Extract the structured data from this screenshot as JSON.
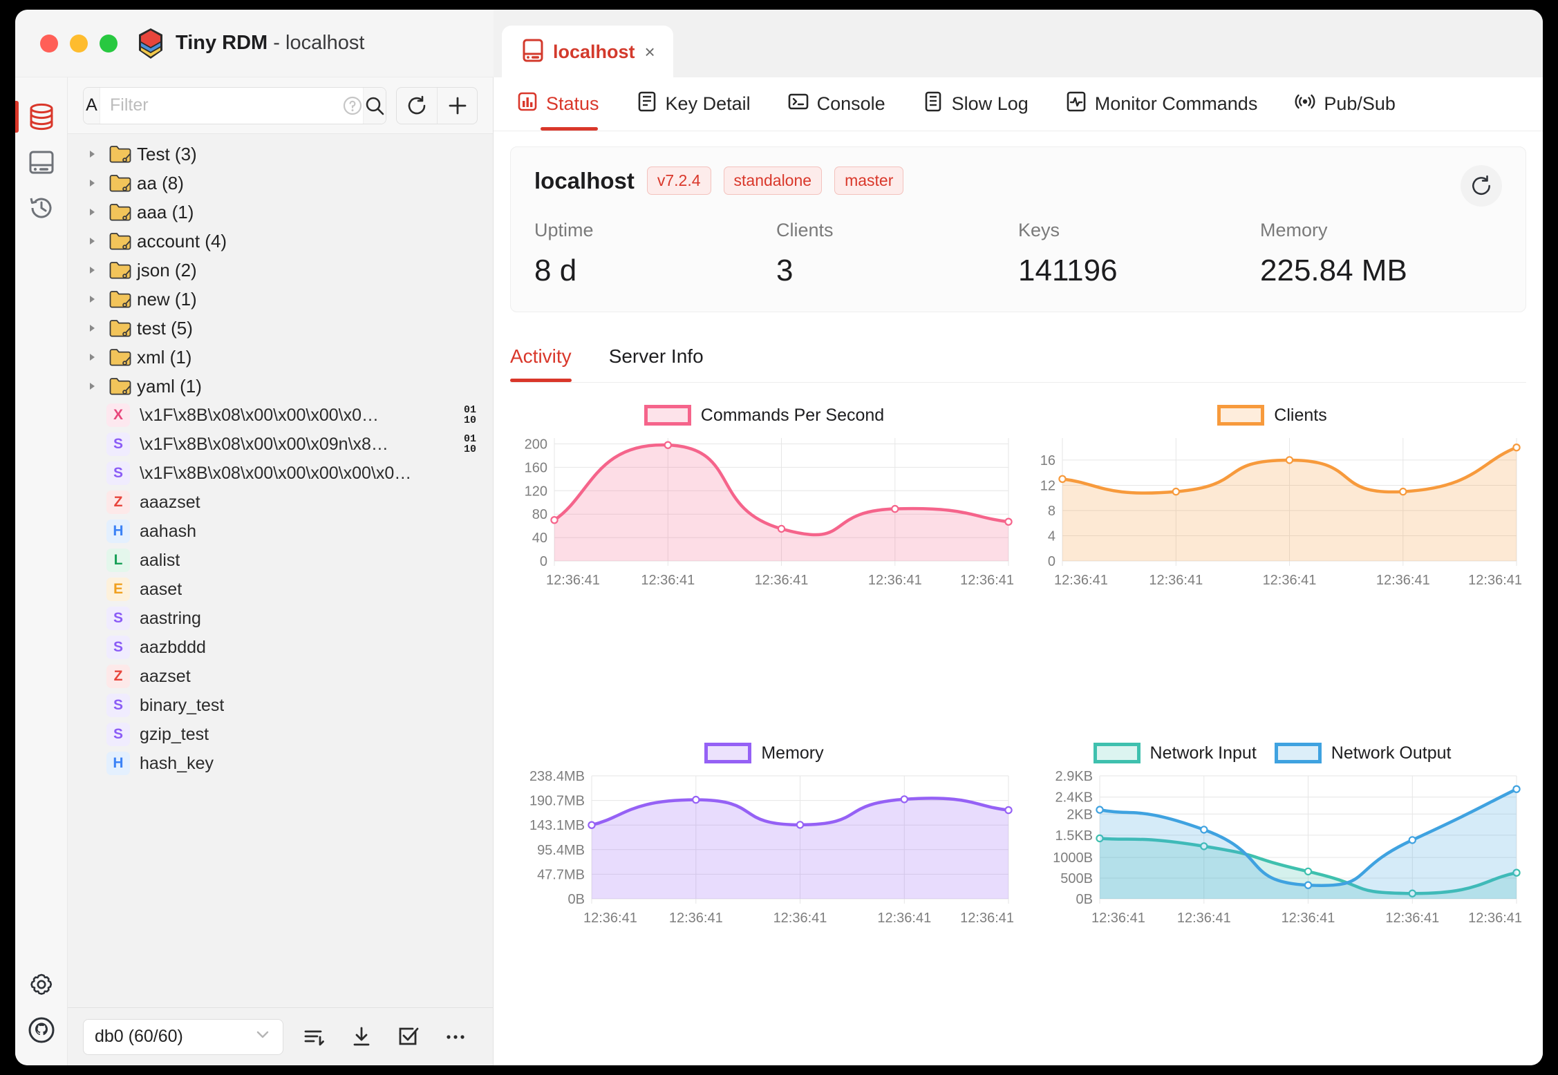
{
  "window": {
    "app_name": "Tiny RDM",
    "title_separator": "-",
    "connection": "localhost",
    "traffic_lights": [
      "close",
      "minimize",
      "zoom"
    ]
  },
  "browser_tab": {
    "label": "localhost",
    "close_label": "×",
    "icon": "server-icon"
  },
  "nav_tabs": [
    {
      "label": "Status",
      "icon": "chart-bar-icon",
      "active": true
    },
    {
      "label": "Key Detail",
      "icon": "list-detail-icon",
      "active": false
    },
    {
      "label": "Console",
      "icon": "terminal-icon",
      "active": false
    },
    {
      "label": "Slow Log",
      "icon": "log-icon",
      "active": false
    },
    {
      "label": "Monitor Commands",
      "icon": "pulse-icon",
      "active": false
    },
    {
      "label": "Pub/Sub",
      "icon": "broadcast-icon",
      "active": false
    }
  ],
  "rail": {
    "items": [
      {
        "name": "database-icon",
        "active": true
      },
      {
        "name": "server-icon",
        "active": false
      },
      {
        "name": "history-icon",
        "active": false
      }
    ],
    "bottom_items": [
      {
        "name": "gear-icon"
      },
      {
        "name": "github-icon"
      }
    ]
  },
  "filter_bar": {
    "prefix_label": "A",
    "placeholder": "Filter",
    "value": "",
    "help_icon": "question-circle-icon",
    "search_icon": "search-icon",
    "refresh_icon": "refresh-icon",
    "add_icon": "plus-icon"
  },
  "tree": {
    "folders": [
      {
        "label": "Test (3)"
      },
      {
        "label": "aa (8)"
      },
      {
        "label": "aaa (1)"
      },
      {
        "label": "account (4)"
      },
      {
        "label": "json (2)"
      },
      {
        "label": "new (1)"
      },
      {
        "label": "test (5)"
      },
      {
        "label": "xml (1)"
      },
      {
        "label": "yaml (1)"
      }
    ],
    "keys": [
      {
        "type": "X",
        "name": "\\x1F\\x8B\\x08\\x00\\x00\\x00\\x0…",
        "binary": true
      },
      {
        "type": "S",
        "name": "\\x1F\\x8B\\x08\\x00\\x00\\x09n\\x8…",
        "binary": true
      },
      {
        "type": "S",
        "name": "\\x1F\\x8B\\x08\\x00\\x00\\x00\\x00\\x0…",
        "binary": false
      },
      {
        "type": "Z",
        "name": "aaazset",
        "binary": false
      },
      {
        "type": "H",
        "name": "aahash",
        "binary": false
      },
      {
        "type": "L",
        "name": "aalist",
        "binary": false
      },
      {
        "type": "E",
        "name": "aaset",
        "binary": false
      },
      {
        "type": "S",
        "name": "aastring",
        "binary": false
      },
      {
        "type": "S",
        "name": "aazbddd",
        "binary": false
      },
      {
        "type": "Z",
        "name": "aazset",
        "binary": false
      },
      {
        "type": "S",
        "name": "binary_test",
        "binary": false
      },
      {
        "type": "S",
        "name": "gzip_test",
        "binary": false
      },
      {
        "type": "H",
        "name": "hash_key",
        "binary": false
      }
    ],
    "binary_badge": {
      "top": "01",
      "bottom": "10"
    }
  },
  "bottom_bar": {
    "db_selected": "db0 (60/60)",
    "chevron_icon": "chevron-down-icon",
    "icons": [
      "sort-icon",
      "import-icon",
      "checkbox-icon",
      "more-icon"
    ]
  },
  "status": {
    "host": "localhost",
    "tags": [
      "v7.2.4",
      "standalone",
      "master"
    ],
    "refresh_icon": "refresh-icon",
    "stats": [
      {
        "label": "Uptime",
        "value": "8 d"
      },
      {
        "label": "Clients",
        "value": "3"
      },
      {
        "label": "Keys",
        "value": "141196"
      },
      {
        "label": "Memory",
        "value": "225.84 MB"
      }
    ]
  },
  "sub_tabs": [
    {
      "label": "Activity",
      "active": true
    },
    {
      "label": "Server Info",
      "active": false
    }
  ],
  "colors": {
    "accent": "#d9372a",
    "cps": "#f5648b",
    "clients": "#f79a3c",
    "memory": "#9561f5",
    "net_in": "#3fc0ae",
    "net_out": "#3fa2e0"
  },
  "chart_data": [
    {
      "type": "area",
      "title": "Commands Per Second",
      "legend": [
        "Commands Per Second"
      ],
      "legend_position": "top-center",
      "grid": true,
      "x": [
        "12:36:41",
        "12:36:41",
        "12:36:41",
        "12:36:41",
        "12:36:41"
      ],
      "xlabel": "",
      "ylabel": "",
      "ylim": [
        0,
        210
      ],
      "yticks": [
        0,
        40,
        80,
        120,
        160,
        200
      ],
      "ytick_labels": [
        "0",
        "40",
        "80",
        "120",
        "160",
        "200"
      ],
      "series": [
        {
          "name": "Commands Per Second",
          "color": "#f5648b",
          "values": [
            70,
            198,
            55,
            89,
            67
          ]
        }
      ]
    },
    {
      "type": "area",
      "title": "Clients",
      "legend": [
        "Clients"
      ],
      "legend_position": "top-center",
      "grid": true,
      "x": [
        "12:36:41",
        "12:36:41",
        "12:36:41",
        "12:36:41",
        "12:36:41"
      ],
      "xlabel": "",
      "ylabel": "",
      "ylim": [
        0,
        19.5
      ],
      "yticks": [
        0,
        4,
        8,
        12,
        16
      ],
      "ytick_labels": [
        "0",
        "4",
        "8",
        "12",
        "16"
      ],
      "series": [
        {
          "name": "Clients",
          "color": "#f79a3c",
          "values": [
            13,
            11,
            16,
            11,
            18
          ]
        }
      ]
    },
    {
      "type": "area",
      "title": "Memory",
      "legend": [
        "Memory"
      ],
      "legend_position": "top-center",
      "grid": true,
      "x": [
        "12:36:41",
        "12:36:41",
        "12:36:41",
        "12:36:41",
        "12:36:41"
      ],
      "xlabel": "",
      "ylabel": "",
      "ylim": [
        0,
        238.4
      ],
      "yticks": [
        0,
        47.7,
        95.4,
        143.1,
        190.7,
        238.4
      ],
      "ytick_labels": [
        "0B",
        "47.7MB",
        "95.4MB",
        "143.1MB",
        "190.7MB",
        "238.4MB"
      ],
      "series": [
        {
          "name": "Memory",
          "color": "#9561f5",
          "values": [
            143.1,
            192.0,
            143.5,
            193.0,
            172.0
          ]
        }
      ]
    },
    {
      "type": "area",
      "title": "Network",
      "legend": [
        "Network Input",
        "Network Output"
      ],
      "legend_position": "top-center",
      "grid": true,
      "x": [
        "12:36:41",
        "12:36:41",
        "12:36:41",
        "12:36:41",
        "12:36:41"
      ],
      "xlabel": "",
      "ylabel": "",
      "ylim": [
        0,
        2970
      ],
      "yticks": [
        0,
        500,
        1000,
        1536,
        2048,
        2458,
        2970
      ],
      "ytick_labels": [
        "0B",
        "500B",
        "1000B",
        "1.5KB",
        "2KB",
        "2.4KB",
        "2.9KB"
      ],
      "series": [
        {
          "name": "Network Input",
          "color": "#3fc0ae",
          "values": [
            1460,
            1270,
            660,
            130,
            630
          ]
        },
        {
          "name": "Network Output",
          "color": "#3fa2e0",
          "values": [
            2150,
            1670,
            330,
            1420,
            2650
          ]
        }
      ]
    }
  ]
}
